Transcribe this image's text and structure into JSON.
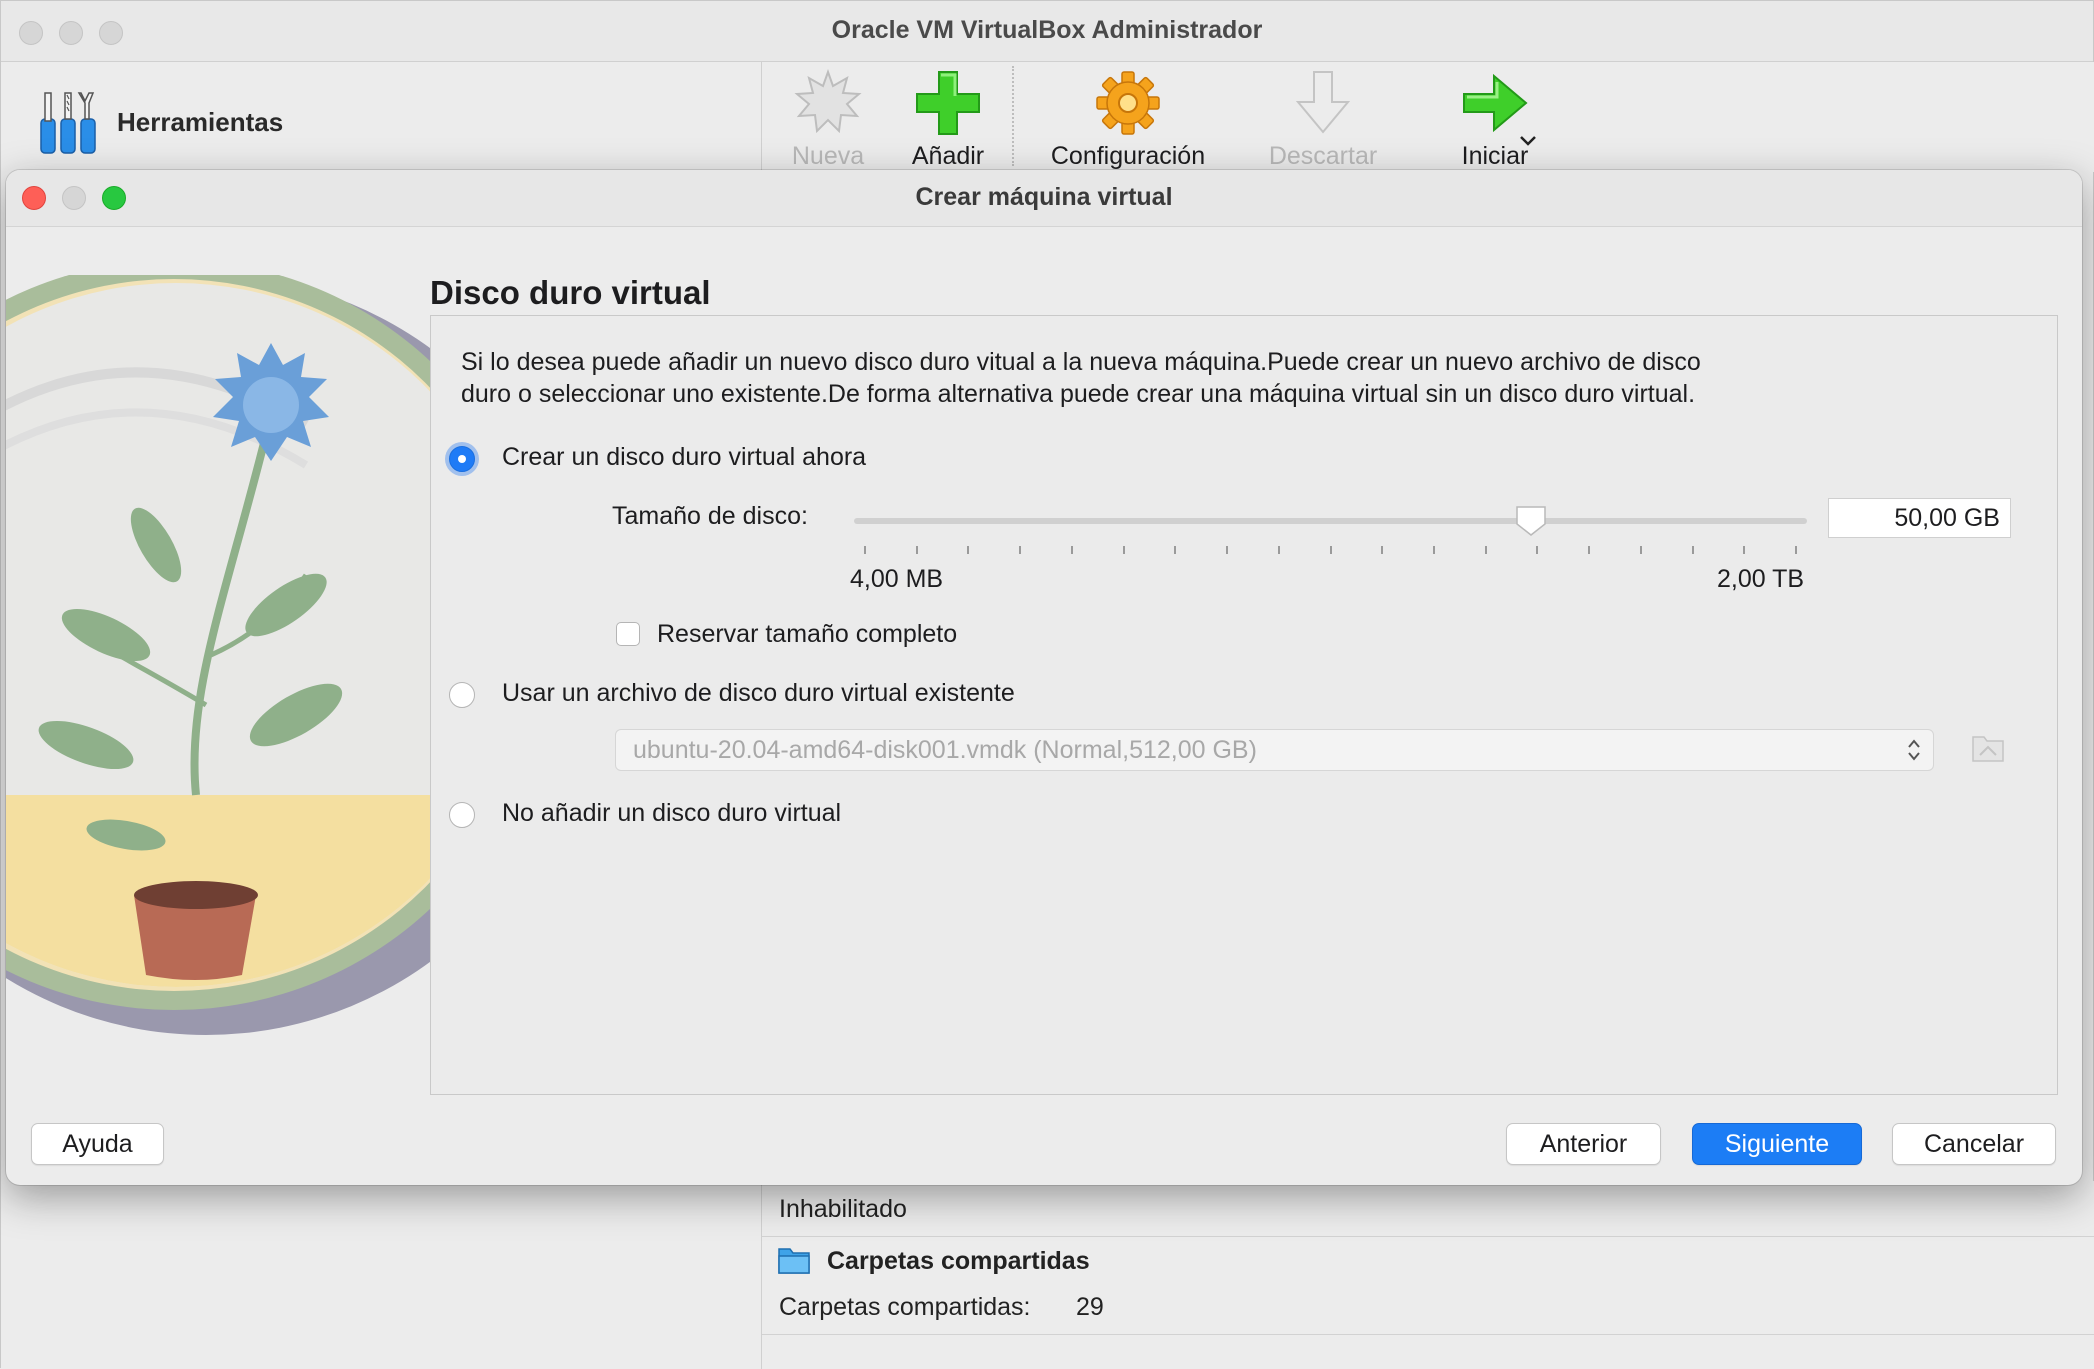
{
  "main_window": {
    "title": "Oracle VM VirtualBox Administrador",
    "tools_label": "Herramientas",
    "toolbar": {
      "new_label": "Nueva",
      "add_label": "Añadir",
      "settings_label": "Configuración",
      "discard_label": "Descartar",
      "start_label": "Iniciar"
    },
    "details": {
      "disabled_text": "Inhabilitado",
      "shared_folders_heading": "Carpetas compartidas",
      "shared_folders_key": "Carpetas compartidas:",
      "shared_folders_value": "29"
    }
  },
  "dialog": {
    "title": "Crear máquina virtual",
    "heading": "Disco duro virtual",
    "description_line1": "Si lo desea puede añadir un nuevo disco duro vitual a la nueva máquina.Puede crear un nuevo archivo de disco",
    "description_line2": "duro o seleccionar uno existente.De forma alternativa puede crear una máquina virtual sin un disco duro virtual.",
    "options": {
      "create_now": {
        "label": "Crear un disco duro virtual ahora",
        "selected": true
      },
      "use_existing": {
        "label": "Usar un archivo de disco duro virtual existente",
        "selected": false
      },
      "no_disk": {
        "label": "No añadir un disco duro virtual",
        "selected": false
      }
    },
    "disk_size": {
      "label": "Tamaño de disco:",
      "value": "50,00 GB",
      "min_label": "4,00 MB",
      "max_label": "2,00 TB",
      "slider_fraction": 0.71
    },
    "reserve_full_size": {
      "label": "Reservar tamaño completo",
      "checked": false
    },
    "existing_file": {
      "value": "ubuntu-20.04-amd64-disk001.vmdk (Normal,512,00 GB)"
    },
    "buttons": {
      "help": "Ayuda",
      "back": "Anterior",
      "next": "Siguiente",
      "cancel": "Cancelar"
    }
  },
  "colors": {
    "accent": "#1c7df5",
    "close": "#fe5f57",
    "zoom": "#28c840"
  }
}
